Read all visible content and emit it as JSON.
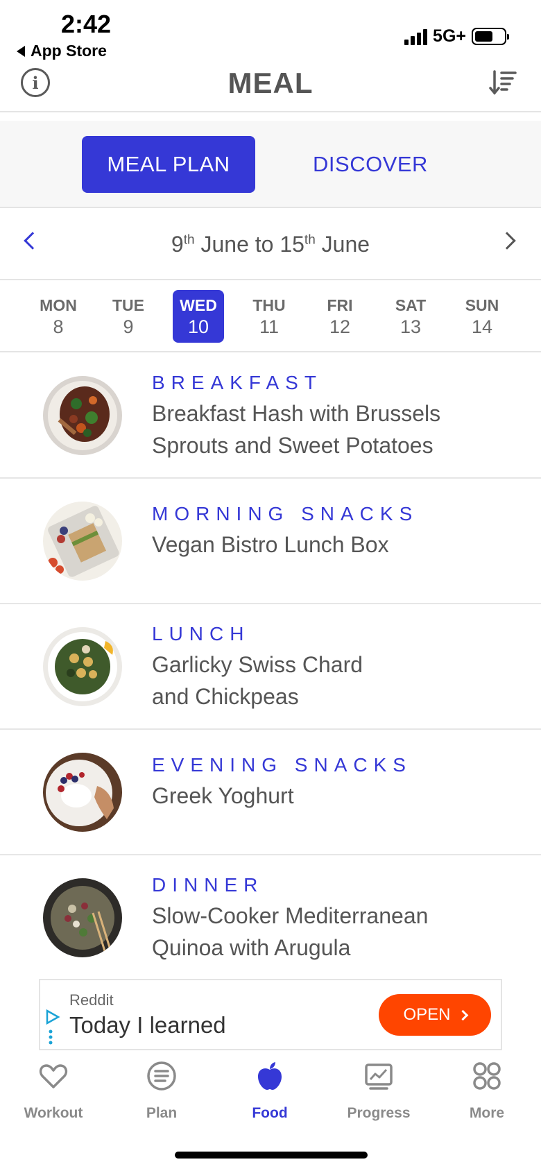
{
  "status_bar": {
    "time": "2:42",
    "back_app": "App Store",
    "network": "5G+"
  },
  "header": {
    "title": "MEAL",
    "info_icon": "info-icon",
    "sort_icon": "sort-icon"
  },
  "segments": {
    "meal_plan": "MEAL PLAN",
    "discover": "DISCOVER",
    "active": "meal_plan"
  },
  "week": {
    "start_day": "9",
    "start_sup": "th",
    "start_month": "June to ",
    "end_day": "15",
    "end_sup": "th",
    "end_month": "June",
    "days": [
      {
        "name": "MON",
        "date": "8",
        "selected": false
      },
      {
        "name": "TUE",
        "date": "9",
        "selected": false
      },
      {
        "name": "WED",
        "date": "10",
        "selected": true
      },
      {
        "name": "THU",
        "date": "11",
        "selected": false
      },
      {
        "name": "FRI",
        "date": "12",
        "selected": false
      },
      {
        "name": "SAT",
        "date": "13",
        "selected": false
      },
      {
        "name": "SUN",
        "date": "14",
        "selected": false
      }
    ]
  },
  "meals": [
    {
      "type": "BREAKFAST",
      "name_line1": "Breakfast Hash with Brussels",
      "name_line2": "Sprouts and Sweet Potatoes"
    },
    {
      "type": "MORNING SNACKS",
      "name_line1": "Vegan Bistro Lunch Box",
      "name_line2": ""
    },
    {
      "type": "LUNCH",
      "name_line1": "Garlicky Swiss Chard",
      "name_line2": "and Chickpeas"
    },
    {
      "type": "EVENING SNACKS",
      "name_line1": "Greek Yoghurt",
      "name_line2": ""
    },
    {
      "type": "DINNER",
      "name_line1": "Slow-Cooker Mediterranean",
      "name_line2": "Quinoa with Arugula"
    }
  ],
  "ad": {
    "source": "Reddit",
    "text": "Today I learned",
    "button": "OPEN"
  },
  "tabs": [
    {
      "label": "Workout",
      "icon": "heart-icon",
      "active": false
    },
    {
      "label": "Plan",
      "icon": "list-icon",
      "active": false
    },
    {
      "label": "Food",
      "icon": "apple-icon",
      "active": true
    },
    {
      "label": "Progress",
      "icon": "chart-icon",
      "active": false
    },
    {
      "label": "More",
      "icon": "grid-icon",
      "active": false
    }
  ],
  "colors": {
    "accent": "#3538d6",
    "ad_button": "#ff4500"
  }
}
